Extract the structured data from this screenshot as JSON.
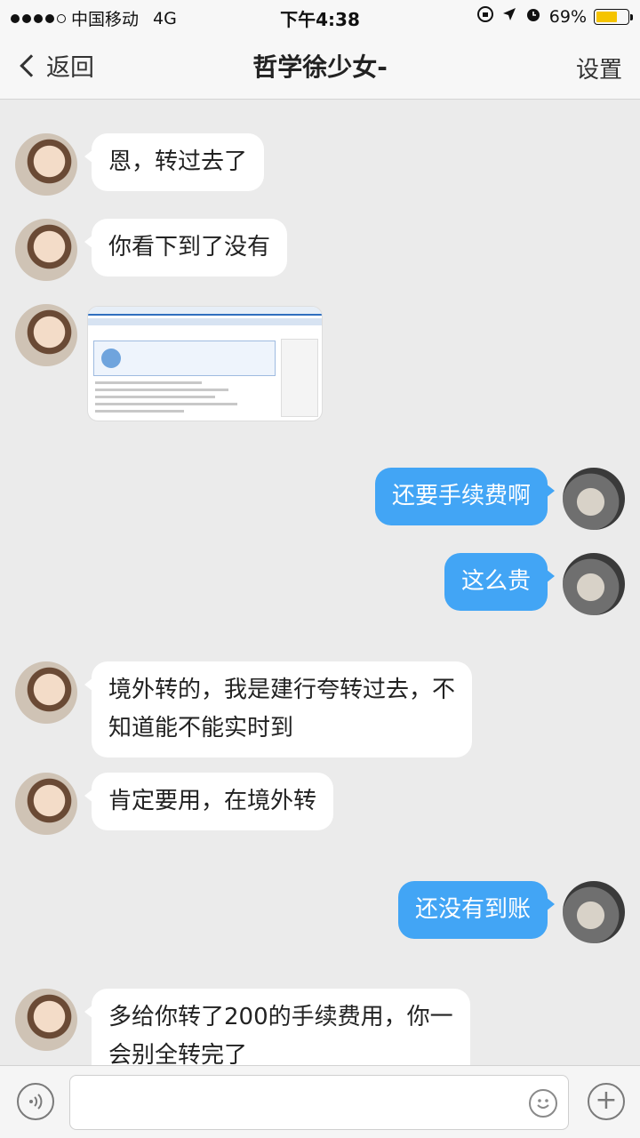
{
  "status_bar": {
    "carrier": "中国移动",
    "network": "4G",
    "time": "下午4:38",
    "battery": "69%",
    "battery_level": 0.69,
    "icons": [
      "orientation-lock-icon",
      "location-arrow-icon",
      "alarm-icon"
    ]
  },
  "nav": {
    "back_label": "返回",
    "title": "哲学徐少女-",
    "settings_label": "设置"
  },
  "messages": [
    {
      "side": "left",
      "text": "恩，转过去了"
    },
    {
      "side": "left",
      "text": "你看下到了没有"
    },
    {
      "side": "left",
      "type": "image",
      "content": "bank-transfer-screenshot"
    },
    {
      "side": "right",
      "text": "还要手续费啊"
    },
    {
      "side": "right",
      "text": "这么贵"
    },
    {
      "side": "left",
      "text_line1": "境外转的，我是建行夸转过去，不",
      "text_line2": "知道能不能实时到"
    },
    {
      "side": "left",
      "text": "肯定要用，在境外转"
    },
    {
      "side": "right",
      "text": "还没有到账"
    },
    {
      "side": "left",
      "text_line1": "多给你转了200的手续费用，你一",
      "text_line2": "会别全转完了"
    }
  ],
  "input": {
    "placeholder": "",
    "icons": [
      "voice-icon",
      "emoji-icon",
      "plus-icon"
    ]
  },
  "colors": {
    "background": "#ebebeb",
    "outgoing_bubble": "#42a5f5",
    "incoming_bubble": "#ffffff",
    "battery": "#f5c400"
  }
}
